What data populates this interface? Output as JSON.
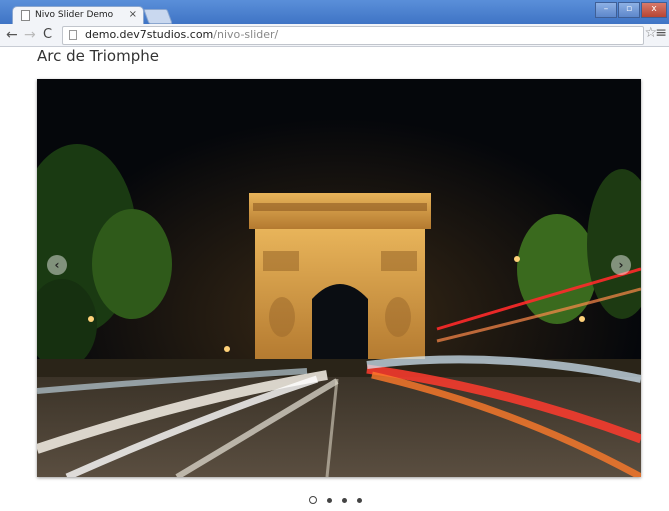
{
  "browser": {
    "tab_title": "Nivo Slider Demo",
    "tab_close": "×",
    "url_domain": "demo.dev7studios.com",
    "url_path": "/nivo-slider/",
    "back_icon": "←",
    "forward_icon": "→",
    "reload_icon": "C",
    "star_icon": "☆",
    "menu_icon": "≡",
    "window_buttons": [
      "–",
      "▫",
      "x"
    ]
  },
  "page": {
    "title": "Arc de Triomphe",
    "prev_label": "‹",
    "next_label": "›"
  },
  "slider": {
    "slide_count": 4,
    "active_slide": 1
  },
  "colors": {
    "titlebar": "#3f74c5",
    "night_sky": "#05070b",
    "arch_stone": "#d9a24a",
    "light_trail_red": "#ff3b2e"
  }
}
